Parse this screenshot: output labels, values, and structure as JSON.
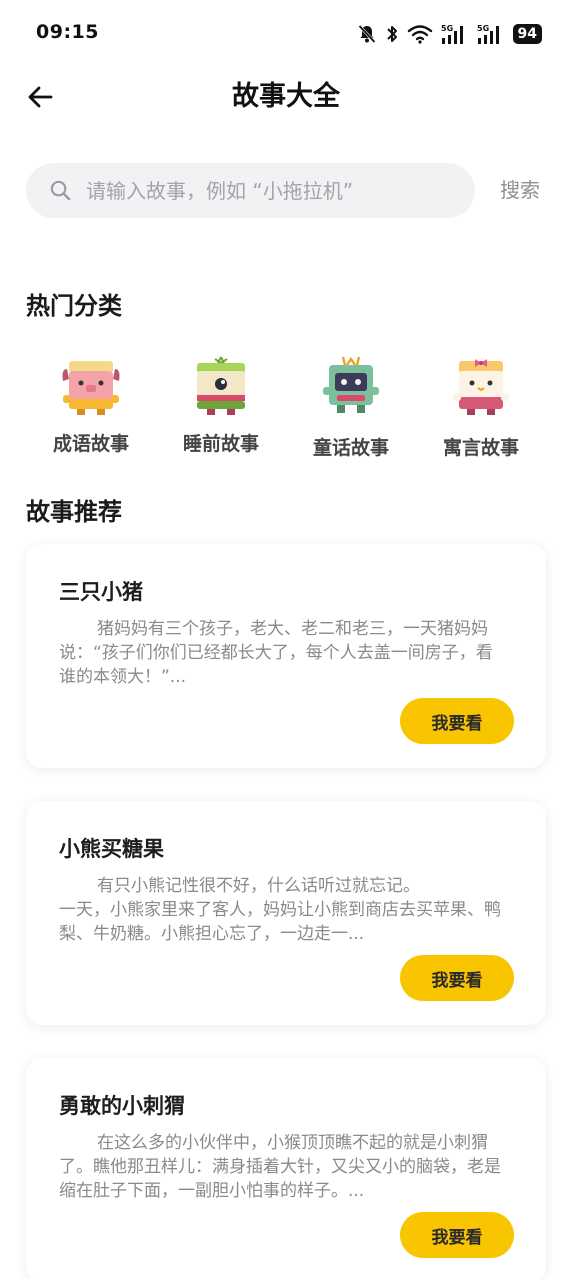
{
  "status_bar": {
    "time": "09:15",
    "battery": "94",
    "network_label": "5G",
    "icons": [
      "mute-bell-icon",
      "bluetooth-icon",
      "wifi-icon",
      "signal-5g-icon",
      "signal-5g-icon",
      "battery-icon"
    ]
  },
  "header": {
    "title": "故事大全",
    "back_icon": "arrow-left-icon"
  },
  "search": {
    "placeholder": "请输入故事，例如 “小拖拉机”",
    "value": "",
    "button_label": "搜索"
  },
  "categories_section": {
    "title": "热门分类",
    "items": [
      {
        "label": "成语故事",
        "icon": "pig-character-icon"
      },
      {
        "label": "睡前故事",
        "icon": "cyclops-character-icon"
      },
      {
        "label": "童话故事",
        "icon": "robot-character-icon"
      },
      {
        "label": "寓言故事",
        "icon": "cat-character-icon"
      }
    ]
  },
  "recommend_section": {
    "title": "故事推荐",
    "stories": [
      {
        "title": "三只小猪",
        "desc": "猪妈妈有三个孩子，老大、老二和老三，一天猪妈妈说：“孩子们你们已经都长大了，每个人去盖一间房子，看谁的本领大！”...",
        "button": "我要看"
      },
      {
        "title": "小熊买糖果",
        "desc": "有只小熊记性很不好，什么话听过就忘记。\n一天，小熊家里来了客人，妈妈让小熊到商店去买苹果、鸭梨、牛奶糖。小熊担心忘了，一边走一...",
        "button": "我要看"
      },
      {
        "title": "勇敢的小刺猬",
        "desc": "在这么多的小伙伴中，小猴顶顶瞧不起的就是小刺猬了。瞧他那丑样儿：满身插着大针，又尖又小的脑袋，老是缩在肚子下面，一副胆小怕事的样子。...",
        "button": "我要看"
      }
    ]
  },
  "colors": {
    "accent": "#f8c500",
    "search_bg": "#f2f2f4",
    "muted_text": "#8a8a8e"
  }
}
